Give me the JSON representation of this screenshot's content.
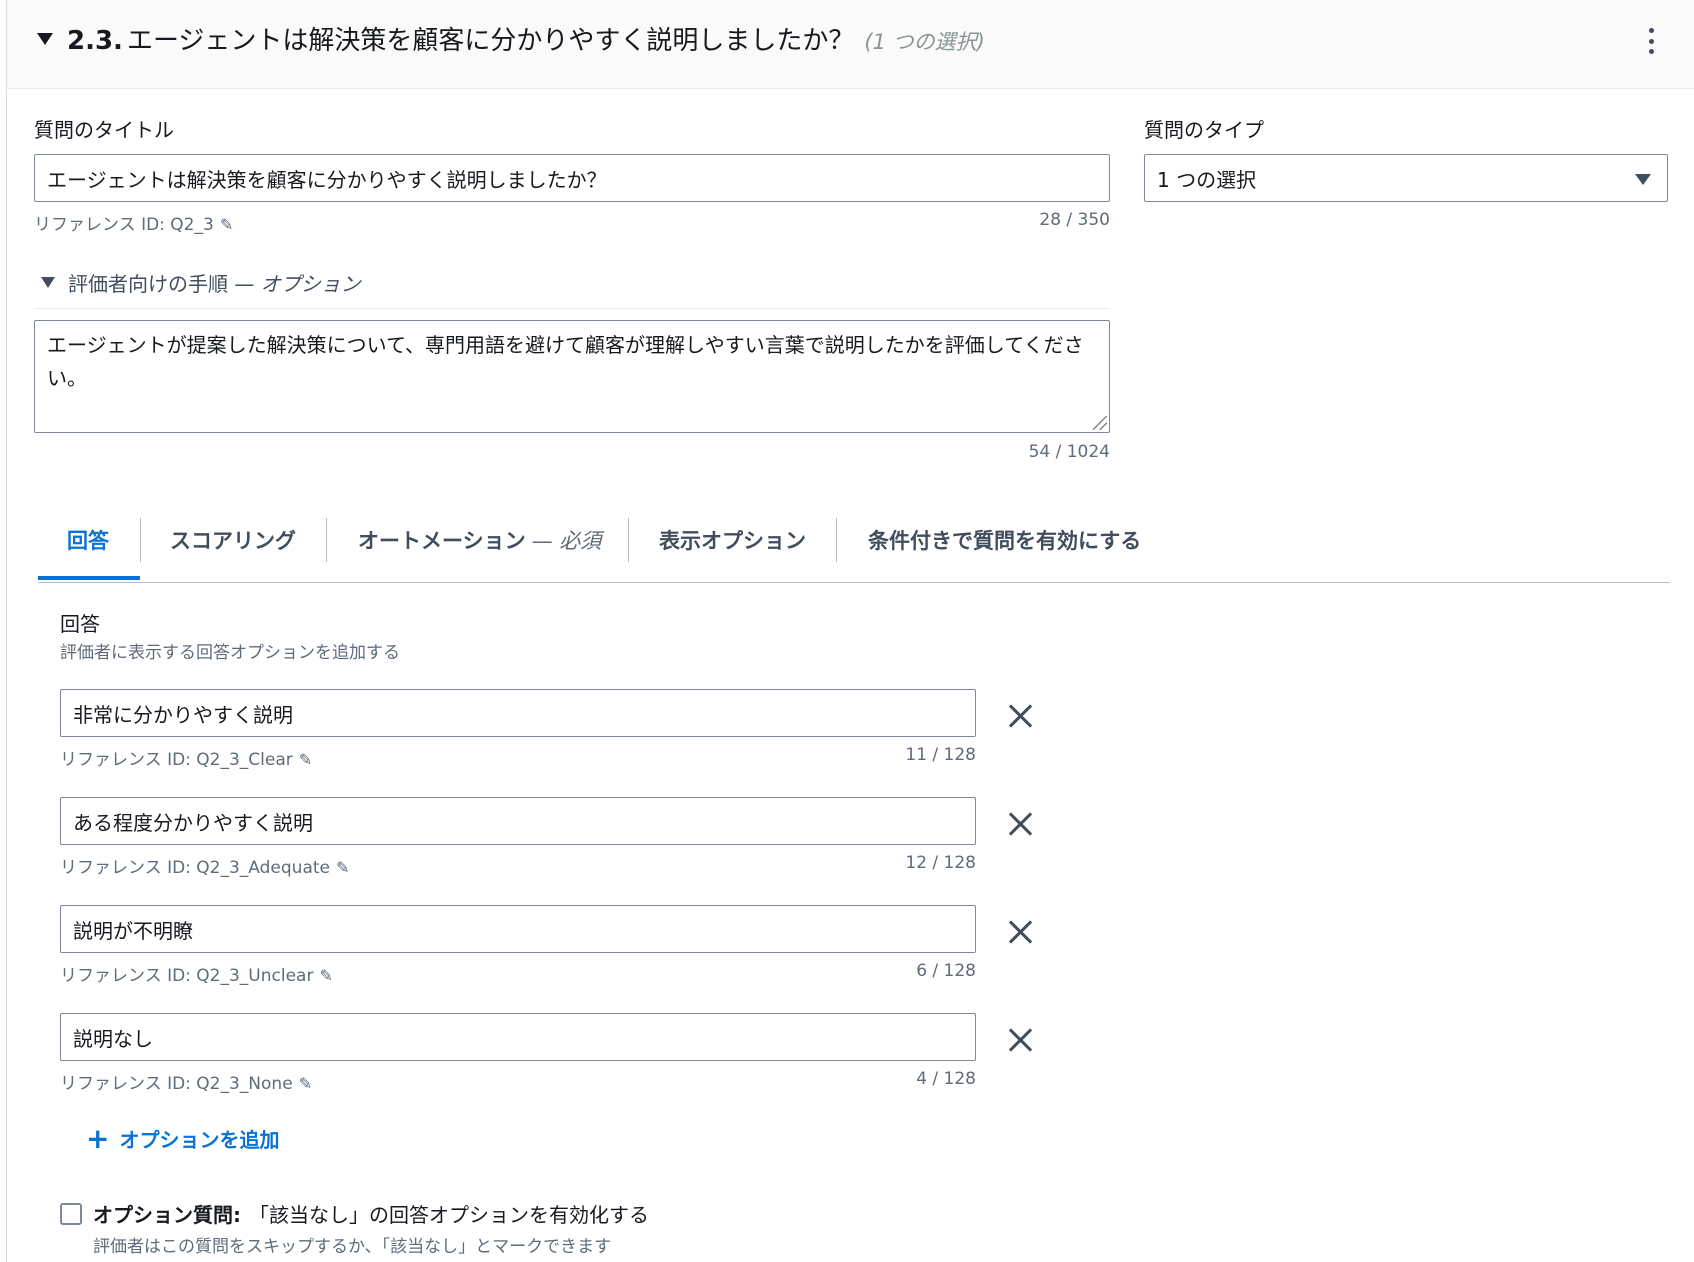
{
  "header": {
    "number": "2.3.",
    "title": "エージェントは解決策を顧客に分かりやすく説明しましたか？",
    "meta": "(1 つの選択)"
  },
  "question_title": {
    "label": "質問のタイトル",
    "value": "エージェントは解決策を顧客に分かりやすく説明しましたか？",
    "reference": "リファレンス ID: Q2_3",
    "count": "28 / 350"
  },
  "question_type": {
    "label": "質問のタイプ",
    "value": "1 つの選択"
  },
  "instructions": {
    "label": "評価者向けの手順 —",
    "optional": "オプション",
    "value": "エージェントが提案した解決策について、専門用語を避けて顧客が理解しやすい言葉で説明したかを評価してください。",
    "count": "54 / 1024"
  },
  "tabs": [
    {
      "label": "回答",
      "suffix": ""
    },
    {
      "label": "スコアリング",
      "suffix": ""
    },
    {
      "label": "オートメーション",
      "suffix": "— 必須"
    },
    {
      "label": "表示オプション",
      "suffix": ""
    },
    {
      "label": "条件付きで質問を有効にする",
      "suffix": ""
    }
  ],
  "answers": {
    "title": "回答",
    "description": "評価者に表示する回答オプションを追加する",
    "options": [
      {
        "value": "非常に分かりやすく説明",
        "reference": "リファレンス ID: Q2_3_Clear",
        "count": "11 / 128"
      },
      {
        "value": "ある程度分かりやすく説明",
        "reference": "リファレンス ID: Q2_3_Adequate",
        "count": "12 / 128"
      },
      {
        "value": "説明が不明瞭",
        "reference": "リファレンス ID: Q2_3_Unclear",
        "count": "6 / 128"
      },
      {
        "value": "説明なし",
        "reference": "リファレンス ID: Q2_3_None",
        "count": "4 / 128"
      }
    ],
    "add_option": "オプションを追加"
  },
  "optional_question": {
    "bold": "オプション質問:",
    "label": "「該当なし」の回答オプションを有効化する",
    "description": "評価者はこの質問をスキップするか、「該当なし」とマークできます",
    "checked": false
  },
  "colors": {
    "accent": "#0972d3",
    "border": "#7d8998",
    "muted": "#5f6b7a"
  }
}
